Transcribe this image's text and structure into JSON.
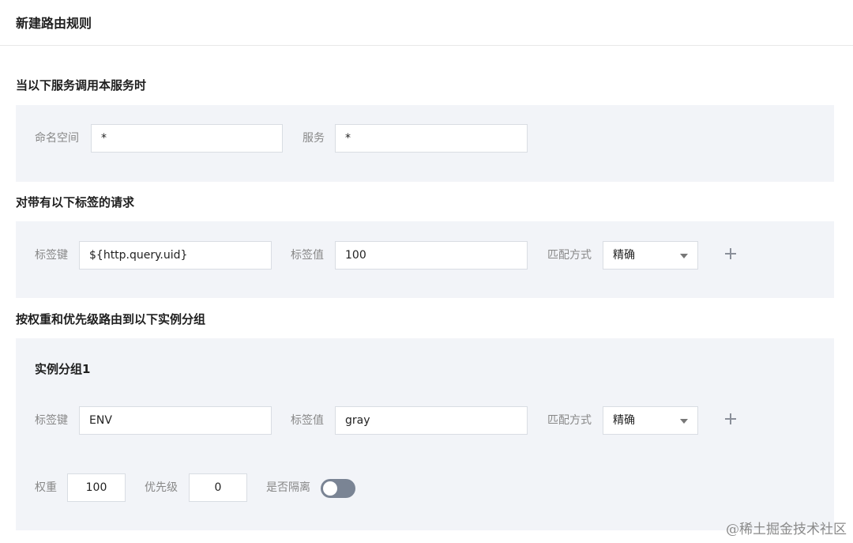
{
  "page": {
    "title": "新建路由规则"
  },
  "caller_section": {
    "title": "当以下服务调用本服务时",
    "namespace_label": "命名空间",
    "namespace_value": "*",
    "service_label": "服务",
    "service_value": "*"
  },
  "request_tags_section": {
    "title": "对带有以下标签的请求",
    "tag_key_label": "标签键",
    "tag_key_value": "${http.query.uid}",
    "tag_value_label": "标签值",
    "tag_value_value": "100",
    "match_label": "匹配方式",
    "match_value": "精确"
  },
  "routing_section": {
    "title": "按权重和优先级路由到以下实例分组",
    "group": {
      "title": "实例分组1",
      "tag_key_label": "标签键",
      "tag_key_value": "ENV",
      "tag_value_label": "标签值",
      "tag_value_value": "gray",
      "match_label": "匹配方式",
      "match_value": "精确",
      "weight_label": "权重",
      "weight_value": "100",
      "priority_label": "优先级",
      "priority_value": "0",
      "isolate_label": "是否隔离",
      "isolate_on": false
    }
  },
  "icons": {
    "add_tag": "plus-icon",
    "dropdown": "chevron-down-icon"
  },
  "colors": {
    "panel_bg": "#f2f4f8",
    "label": "#888888",
    "toggle_off": "#7a8494"
  },
  "watermark": "@稀土掘金技术社区"
}
